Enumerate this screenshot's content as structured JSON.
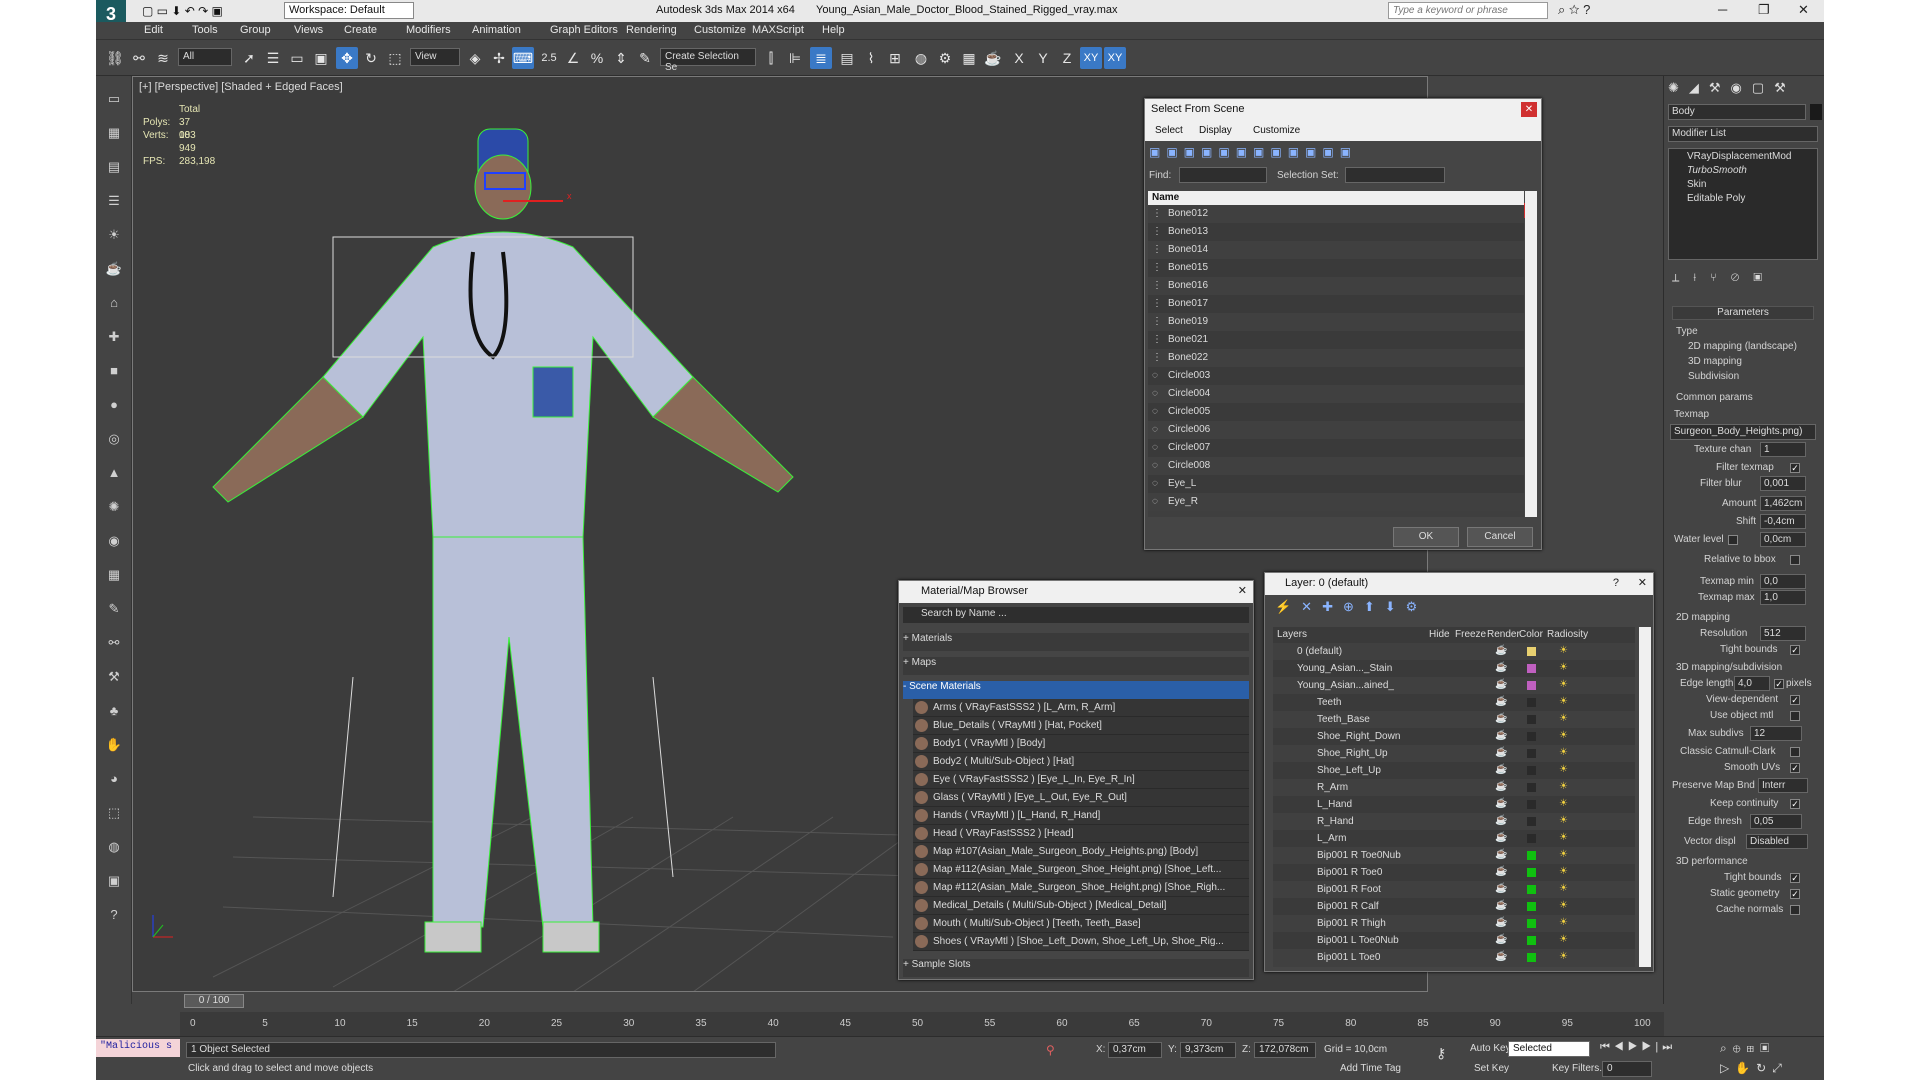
{
  "title": {
    "app": "Autodesk 3ds Max  2014 x64",
    "file": "Young_Asian_Male_Doctor_Blood_Stained_Rigged_vray.max",
    "workspace": "Workspace: Default",
    "search_placeholder": "Type a keyword or phrase"
  },
  "menu": [
    "Edit",
    "Tools",
    "Group",
    "Views",
    "Create",
    "Modifiers",
    "Animation",
    "Graph Editors",
    "Rendering",
    "Customize",
    "MAXScript",
    "Help"
  ],
  "toolbar": {
    "filter": "All",
    "refcoord": "View",
    "angle": "2.5",
    "named_sel": "Create Selection Se",
    "axes": [
      "X",
      "Y",
      "Z",
      "XY"
    ]
  },
  "viewport": {
    "label": "[+] [Perspective] [Shaded + Edged Faces]",
    "stats": {
      "total": "Total",
      "polys_label": "Polys:",
      "polys": "37 003",
      "verts_label": "Verts:",
      "verts": "18 949",
      "fps_label": "FPS:",
      "fps": "283,198"
    },
    "gizmo_axis": "x"
  },
  "select_scene": {
    "title": "Select From Scene",
    "menu": [
      "Select",
      "Display",
      "Customize"
    ],
    "find_label": "Find:",
    "selset_label": "Selection Set:",
    "col_name": "Name",
    "items": [
      "Bone012",
      "Bone013",
      "Bone014",
      "Bone015",
      "Bone016",
      "Bone017",
      "Bone019",
      "Bone021",
      "Bone022",
      "Circle003",
      "Circle004",
      "Circle005",
      "Circle006",
      "Circle007",
      "Circle008",
      "Eye_L",
      "Eye_R"
    ],
    "ok": "OK",
    "cancel": "Cancel"
  },
  "material_browser": {
    "title": "Material/Map Browser",
    "search": "Search by Name ...",
    "groups": [
      "+ Materials",
      "+ Maps",
      "- Scene Materials"
    ],
    "items": [
      "Arms  ( VRayFastSSS2 ) [L_Arm, R_Arm]",
      "Blue_Details  ( VRayMtl ) [Hat, Pocket]",
      "Body1  ( VRayMtl ) [Body]",
      "Body2  ( Multi/Sub-Object ) [Hat]",
      "Eye  ( VRayFastSSS2 ) [Eye_L_In, Eye_R_In]",
      "Glass  ( VRayMtl ) [Eye_L_Out, Eye_R_Out]",
      "Hands  ( VRayMtl ) [L_Hand, R_Hand]",
      "Head  ( VRayFastSSS2 ) [Head]",
      "Map #107(Asian_Male_Surgeon_Body_Heights.png) [Body]",
      "Map #112(Asian_Male_Surgeon_Shoe_Height.png) [Shoe_Left...",
      "Map #112(Asian_Male_Surgeon_Shoe_Height.png) [Shoe_Righ...",
      "Medical_Details  ( Multi/Sub-Object ) [Medical_Detail]",
      "Mouth  ( Multi/Sub-Object ) [Teeth, Teeth_Base]",
      "Shoes  ( VRayMtl ) [Shoe_Left_Down, Shoe_Left_Up, Shoe_Rig..."
    ],
    "sample_slots": "+ Sample Slots"
  },
  "layer": {
    "title": "Layer: 0 (default)",
    "help": "?",
    "cols": [
      "Layers",
      "Hide",
      "Freeze",
      "Render",
      "Color",
      "Radiosity"
    ],
    "items": [
      "0 (default)",
      "Young_Asian..._Stain",
      "Young_Asian...ained_",
      "Teeth",
      "Teeth_Base",
      "Shoe_Right_Down",
      "Shoe_Right_Up",
      "Shoe_Left_Up",
      "R_Arm",
      "L_Hand",
      "R_Hand",
      "L_Arm",
      "Bip001 R Toe0Nub",
      "Bip001 R Toe0",
      "Bip001 R Foot",
      "Bip001 R Calf",
      "Bip001 R Thigh",
      "Bip001 L Toe0Nub",
      "Bip001 L Toe0"
    ],
    "colors": [
      "#e8d070",
      "#c060c0",
      "#c060c0",
      "#2a2a2a",
      "#2a2a2a",
      "#2a2a2a",
      "#2a2a2a",
      "#2a2a2a",
      "#2a2a2a",
      "#2a2a2a",
      "#2a2a2a",
      "#2a2a2a",
      "#10c010",
      "#10c010",
      "#10c010",
      "#10c010",
      "#10c010",
      "#10c010",
      "#10c010"
    ]
  },
  "command": {
    "object": "Body",
    "modlist": "Modifier List",
    "stack": [
      "VRayDisplacementMod",
      "TurboSmooth",
      "Skin",
      "Editable Poly"
    ],
    "params": "Parameters",
    "type_label": "Type",
    "types": [
      "2D mapping (landscape)",
      "3D mapping",
      "Subdivision"
    ],
    "common": "Common params",
    "texmap_label": "Texmap",
    "texmap": "Surgeon_Body_Heights.png)",
    "texchan_label": "Texture chan",
    "texchan": "1",
    "filter_label": "Filter texmap",
    "blur_label": "Filter blur",
    "blur": "0,001",
    "amount_label": "Amount",
    "amount": "1,462cm",
    "shift_label": "Shift",
    "shift": "-0,4cm",
    "water_label": "Water level",
    "water": "0,0cm",
    "rel_label": "Relative to bbox",
    "tmin_label": "Texmap min",
    "tmin": "0,0",
    "tmax_label": "Texmap max",
    "tmax": "1,0",
    "map2d": "2D mapping",
    "res_label": "Resolution",
    "res": "512",
    "tight_label": "Tight bounds",
    "map3d": "3D mapping/subdivision",
    "edge_label": "Edge length",
    "edge": "4,0",
    "pixels": "pixels",
    "viewdep": "View-dependent",
    "useobj": "Use object mtl",
    "maxsub_label": "Max subdivs",
    "maxsub": "12",
    "classic": "Classic Catmull-Clark",
    "smooth": "Smooth UVs",
    "preserve_label": "Preserve Map Bnd",
    "preserve": "Interr",
    "keepcont": "Keep continuity",
    "thresh_label": "Edge thresh",
    "thresh": "0,05",
    "vector_label": "Vector displ",
    "vector": "Disabled",
    "perf": "3D performance",
    "tight2": "Tight bounds",
    "static": "Static geometry",
    "cache": "Cache normals"
  },
  "timeline": {
    "frame": "0 / 100",
    "ticks": [
      "0",
      "5",
      "10",
      "15",
      "20",
      "25",
      "30",
      "35",
      "40",
      "45",
      "50",
      "55",
      "60",
      "65",
      "70",
      "75",
      "80",
      "85",
      "90",
      "95",
      "100"
    ]
  },
  "status": {
    "script": "\"Malicious s",
    "selected": "1 Object Selected",
    "prompt": "Click and drag to select and move objects",
    "x_label": "X:",
    "x": "0,37cm",
    "y_label": "Y:",
    "y": "9,373cm",
    "z_label": "Z:",
    "z": "172,078cm",
    "grid": "Grid = 10,0cm",
    "addtime": "Add Time Tag",
    "autokey": "Auto Key",
    "setkey": "Set Key",
    "selmode": "Selected",
    "keyfilters": "Key Filters...",
    "frame": "0"
  }
}
